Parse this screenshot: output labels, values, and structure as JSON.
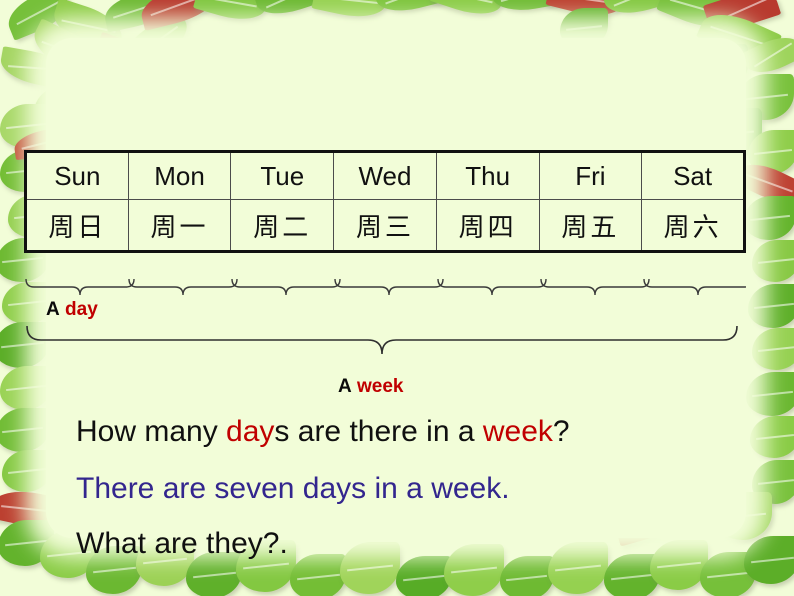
{
  "slide": {
    "background_color": "#F2FDD8",
    "theme": "leaf-border-template",
    "accent_red": "#C00000",
    "accent_green": "#A6CE20",
    "accent_blue": "#33268E"
  },
  "table": {
    "columns": [
      {
        "en": "Sun",
        "zh": "周日",
        "en_color": "#C00000"
      },
      {
        "en": "Mon",
        "zh": "周一",
        "en_color": "#111111"
      },
      {
        "en": "Tue",
        "zh": "周二",
        "en_color": "#111111"
      },
      {
        "en": "Wed",
        "zh": "周三",
        "en_color": "#111111"
      },
      {
        "en": "Thu",
        "zh": "周四",
        "en_color": "#111111"
      },
      {
        "en": "Fri",
        "zh": "周五",
        "en_color": "#111111"
      },
      {
        "en": "Sat",
        "zh": "周六",
        "en_color": "#A6CE20"
      }
    ]
  },
  "labels": {
    "day": {
      "prefix": "A",
      "word": "day"
    },
    "week": {
      "prefix": "A",
      "word": "week"
    }
  },
  "sentences": {
    "question": {
      "part1": "How many ",
      "highlight1": "day",
      "part2": "s are there in a ",
      "highlight2": "week",
      "part3": "?"
    },
    "answer": "There are seven days in a week.",
    "followup": "What are they?."
  }
}
